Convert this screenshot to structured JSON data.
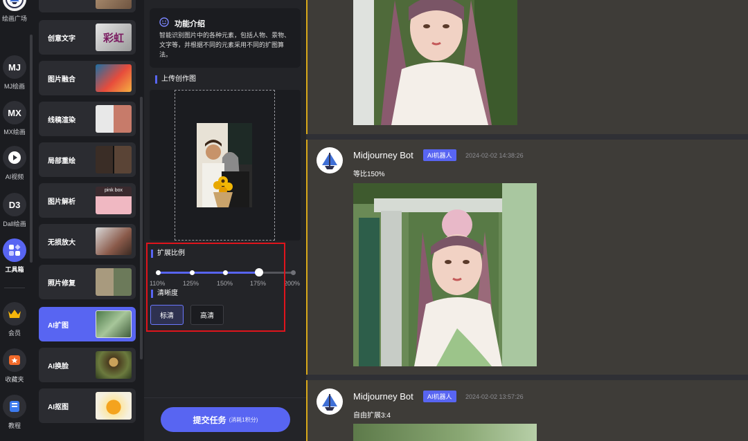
{
  "rail": {
    "items": [
      {
        "label": "绘画广场",
        "icon": "art-gallery-icon"
      },
      {
        "label": "MJ绘画",
        "icon_text": "MJ"
      },
      {
        "label": "MX绘画",
        "icon_text": "MX"
      },
      {
        "label": "AI视频",
        "icon": "play-icon"
      },
      {
        "label": "Dall绘画",
        "icon_text": "D3"
      },
      {
        "label": "工具箱",
        "icon": "toolbox-icon"
      },
      {
        "label": "会员",
        "icon": "crown-icon"
      },
      {
        "label": "收藏夹",
        "icon": "favorites-icon"
      },
      {
        "label": "教程",
        "icon": "tutorial-icon"
      }
    ]
  },
  "tools": {
    "items": [
      {
        "label": "创意文字"
      },
      {
        "label": "图片融合"
      },
      {
        "label": "线稿渲染"
      },
      {
        "label": "局部重绘"
      },
      {
        "label": "图片解析",
        "thumb_text": "pink box"
      },
      {
        "label": "无损放大"
      },
      {
        "label": "照片修复"
      },
      {
        "label": "AI扩图"
      },
      {
        "label": "AI换脸"
      },
      {
        "label": "AI抠图"
      }
    ],
    "creative_text_thumb": "彩虹",
    "active_index": 7
  },
  "panel": {
    "intro_title": "功能介绍",
    "intro_body": "智能识别图片中的各种元素，包括人物、景物、文字等，并根据不同的元素采用不同的扩图算法。",
    "upload_label": "上传创作图",
    "scale_label": "扩展比例",
    "scale_ticks": [
      "110%",
      "125%",
      "150%",
      "175%",
      "200%"
    ],
    "scale_selected": "175%",
    "clarity_label": "清晰度",
    "clarity_options": [
      "标清",
      "高清"
    ],
    "clarity_selected": "标清",
    "submit_label": "提交任务",
    "submit_sub": "(消耗1积分)"
  },
  "chat": {
    "messages": [
      {
        "name": "Midjourney Bot",
        "badge": "AI机器人",
        "time": "2024-02-02 14:38:26",
        "text": "等比150%"
      },
      {
        "name": "Midjourney Bot",
        "badge": "AI机器人",
        "time": "2024-02-02 13:57:26",
        "text": "自由扩展3:4"
      }
    ]
  },
  "colors": {
    "accent": "#5865f2",
    "highlight_box": "#e0141c",
    "chat_bg": "#3e3c38",
    "panel_bg": "#232428",
    "marker": "#d9a91a"
  }
}
